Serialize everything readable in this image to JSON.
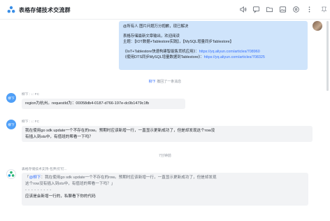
{
  "header": {
    "title": "表格存储技术交流群",
    "icons": [
      "speaker-icon",
      "chat-icon",
      "folder-icon",
      "image-icon",
      "settings-icon",
      "more-icon",
      "pin-icon"
    ]
  },
  "colors": {
    "accent": "#3370ff",
    "bubble_self": "#cfe4fb",
    "bubble_other": "#f2f3f5",
    "avatar": "#4f9ff7"
  },
  "my_message": {
    "line1": "@所有人  图片问题万分抱歉，现已解决",
    "line2": "表格存储最新文章输出，欢迎阅读",
    "line3": "主题：【IOT数据+Tablestore实践】，【MySQL增量同步Tablestore】",
    "line4_text": "《IoT+Tablestore快速构建智能售货机应用》：",
    "line4_link": "https://yq.aliyun.com/articles/708960",
    "line5_text": "《使用DTS同步MySQL增量数据到Tablestore》：",
    "line5_link": "https://yq.aliyun.com/articles/708325"
  },
  "recall_notice": {
    "who": "柳下",
    "text": "撤回了一条消息"
  },
  "message1": {
    "avatar_text": "柳下",
    "sender": "柳下      : ↓: FC",
    "text": "region为杭州。requestId为：00058db4-0187-d766-197e-dc0b1479c1fb"
  },
  "message2": {
    "avatar_text": "柳下",
    "sender": "柳下      : ↓: FC",
    "line1": "我在使用go sdk update一个不存在的row。预期时应该新增一行，一直显示更新成功了，但是却发现这个row没",
    "line2": "有插入到ots中，有值班的帮看一下吗？"
  },
  "time_divider": "7分钟前",
  "message3": {
    "sender": "表格存储技术支持-包弃(钉钉...",
    "quote_open": "「",
    "quote_at": "@柳下",
    "quote_line1": "：我在使用go sdk update一个不存在的row。预期时应该新增一行，一直显示更新成功了，但是却发现",
    "quote_line2": "这个row没有插入到ots中，有值班的帮看一下吗？」",
    "divider": "- - - - - - - - -",
    "reply": "应该是会新增一行的，私聊看下你的代码"
  }
}
